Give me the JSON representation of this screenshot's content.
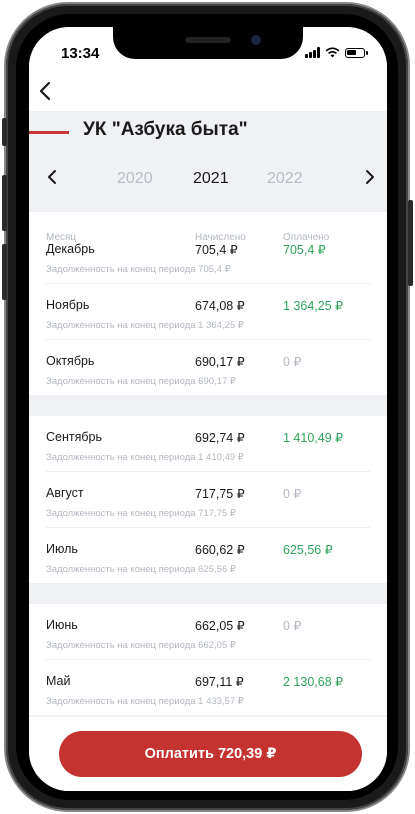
{
  "status": {
    "time": "13:34"
  },
  "header": {
    "title": "УК \"Азбука быта\""
  },
  "years": {
    "prev": "2020",
    "current": "2021",
    "next": "2022"
  },
  "columns": {
    "month": "Месяц",
    "charged": "Начислено",
    "paid": "Оплачено"
  },
  "rows": [
    {
      "month": "Декабрь",
      "charged": "705,4 ₽",
      "paid": "705,4 ₽",
      "debt": "Задолженность на конец периода 705,4 ₽"
    },
    {
      "month": "Ноябрь",
      "charged": "674,08 ₽",
      "paid": "1 364,25 ₽",
      "debt": "Задолженность на конец периода 1 364,25 ₽"
    },
    {
      "month": "Октябрь",
      "charged": "690,17 ₽",
      "paid": "0 ₽",
      "debt": "Задолженность на конец периода 690,17 ₽"
    },
    {
      "month": "Сентябрь",
      "charged": "692,74 ₽",
      "paid": "1 410,49 ₽",
      "debt": "Задолженность на конец периода 1 410,49 ₽"
    },
    {
      "month": "Август",
      "charged": "717,75 ₽",
      "paid": "0 ₽",
      "debt": "Задолженность на конец периода 717,75 ₽"
    },
    {
      "month": "Июль",
      "charged": "660,62 ₽",
      "paid": "625,56 ₽",
      "debt": "Задолженность на конец периода 625,56 ₽"
    },
    {
      "month": "Июнь",
      "charged": "662,05 ₽",
      "paid": "0 ₽",
      "debt": "Задолженность на конец периода 662,05 ₽"
    },
    {
      "month": "Май",
      "charged": "697,11 ₽",
      "paid": "2 130,68 ₽",
      "debt": "Задолженность на конец периода 1 433,57 ₽"
    }
  ],
  "pay_button": {
    "label": "Оплатить 720,39 ₽"
  },
  "colors": {
    "accent": "#c4332f",
    "paid_positive": "#2fa35b",
    "muted": "#b3b8c0"
  }
}
